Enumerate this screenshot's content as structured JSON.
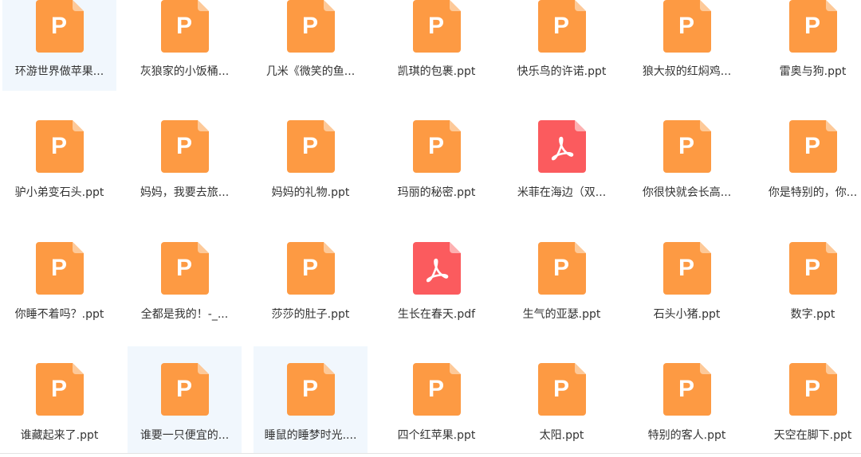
{
  "colors": {
    "ppt": "#fd9a43",
    "ppt_fold": "#fdc999",
    "pdf": "#fb5b5e",
    "pdf_fold": "#fdb0b1",
    "highlight": "#f1f7fd"
  },
  "files": [
    {
      "name": "环游世界做苹果...",
      "type": "ppt",
      "highlighted": true
    },
    {
      "name": "灰狼家的小饭桶...",
      "type": "ppt",
      "highlighted": false
    },
    {
      "name": "几米《微笑的鱼...",
      "type": "ppt",
      "highlighted": false
    },
    {
      "name": "凯琪的包裹.ppt",
      "type": "ppt",
      "highlighted": false
    },
    {
      "name": "快乐鸟的许诺.ppt",
      "type": "ppt",
      "highlighted": false
    },
    {
      "name": "狼大叔的红焖鸡...",
      "type": "ppt",
      "highlighted": false
    },
    {
      "name": "雷奥与狗.ppt",
      "type": "ppt",
      "highlighted": false
    },
    {
      "name": "驴小弟变石头.ppt",
      "type": "ppt",
      "highlighted": false
    },
    {
      "name": "妈妈，我要去旅...",
      "type": "ppt",
      "highlighted": false
    },
    {
      "name": "妈妈的礼物.ppt",
      "type": "ppt",
      "highlighted": false
    },
    {
      "name": "玛丽的秘密.ppt",
      "type": "ppt",
      "highlighted": false
    },
    {
      "name": "米菲在海边（双...",
      "type": "pdf",
      "highlighted": false
    },
    {
      "name": "你很快就会长高...",
      "type": "ppt",
      "highlighted": false
    },
    {
      "name": "你是特别的，你...",
      "type": "ppt",
      "highlighted": false
    },
    {
      "name": "你睡不着吗？.ppt",
      "type": "ppt",
      "highlighted": false
    },
    {
      "name": "全都是我的！-_...",
      "type": "ppt",
      "highlighted": false
    },
    {
      "name": "莎莎的肚子.ppt",
      "type": "ppt",
      "highlighted": false
    },
    {
      "name": "生长在春天.pdf",
      "type": "pdf",
      "highlighted": false
    },
    {
      "name": "生气的亚瑟.ppt",
      "type": "ppt",
      "highlighted": false
    },
    {
      "name": "石头小猪.ppt",
      "type": "ppt",
      "highlighted": false
    },
    {
      "name": "数字.ppt",
      "type": "ppt",
      "highlighted": false
    },
    {
      "name": "谁藏起来了.ppt",
      "type": "ppt",
      "highlighted": false
    },
    {
      "name": "谁要一只便宜的...",
      "type": "ppt",
      "highlighted": true
    },
    {
      "name": "睡鼠的睡梦时光....",
      "type": "ppt",
      "highlighted": true
    },
    {
      "name": "四个红苹果.ppt",
      "type": "ppt",
      "highlighted": false
    },
    {
      "name": "太阳.ppt",
      "type": "ppt",
      "highlighted": false
    },
    {
      "name": "特别的客人.ppt",
      "type": "ppt",
      "highlighted": false
    },
    {
      "name": "天空在脚下.ppt",
      "type": "ppt",
      "highlighted": false
    }
  ]
}
